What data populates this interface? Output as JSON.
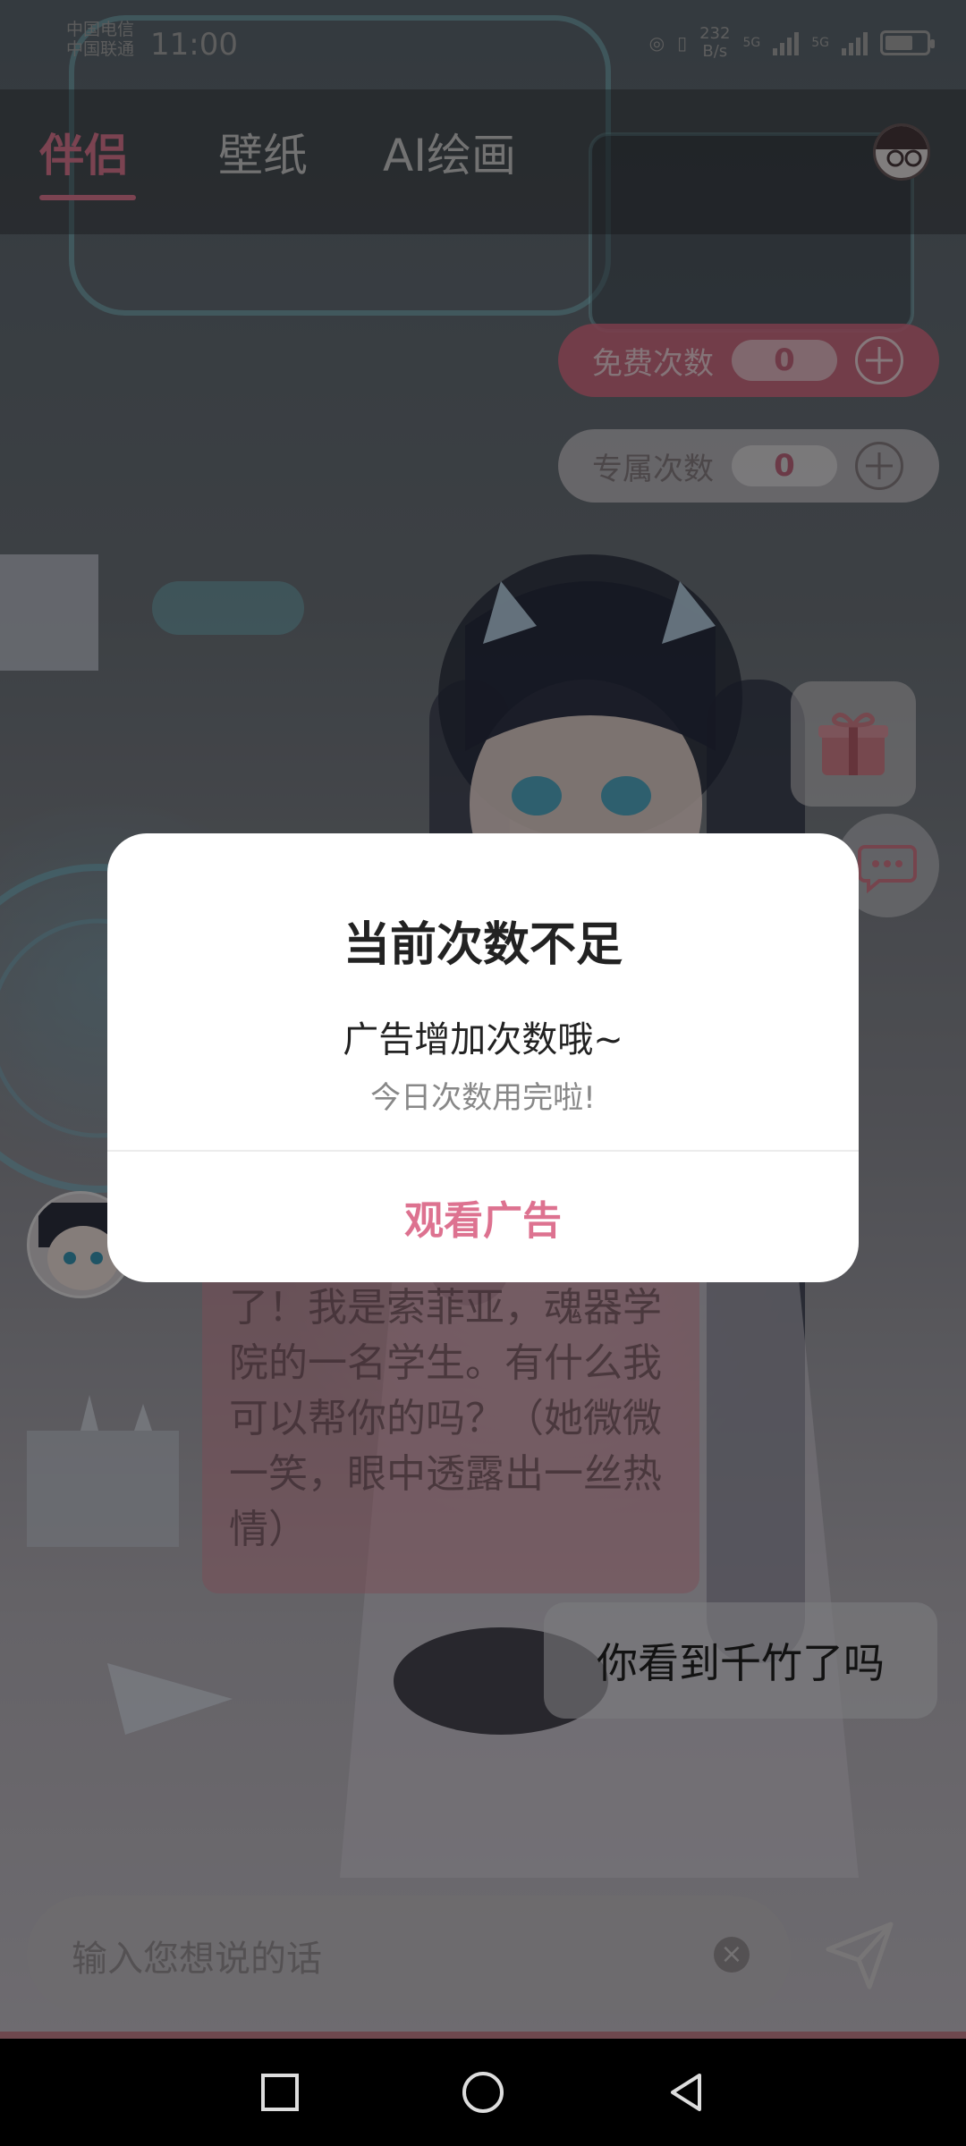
{
  "status_bar": {
    "carrier_1": "中国电信",
    "carrier_2": "中国联通",
    "time": "11:00",
    "speed_value": "232",
    "speed_unit": "B/s",
    "net_1": "5G",
    "net_2": "5G"
  },
  "header": {
    "tabs": [
      {
        "label": "伴侣",
        "active": true
      },
      {
        "label": "壁纸",
        "active": false
      },
      {
        "label": "AI绘画",
        "active": false
      }
    ],
    "accent_color": "#e07a94"
  },
  "counters": {
    "free": {
      "label": "免费次数",
      "value": "0"
    },
    "exclusive": {
      "label": "专属次数",
      "value": "0"
    }
  },
  "chat": {
    "bot_message": "了！我是索菲亚，魂器学院的一名学生。有什么我可以帮你的吗？（她微微一笑，眼中透露出一丝热情）",
    "user_message": "你看到千竹了吗"
  },
  "input": {
    "placeholder": "输入您想说的话"
  },
  "dialog": {
    "title": "当前次数不足",
    "message": "广告增加次数哦~",
    "sub_message": "今日次数用完啦!",
    "action_label": "观看广告"
  },
  "icons": [
    "gift-icon",
    "chat-icon",
    "send-icon",
    "clear-icon",
    "recent-apps-icon",
    "home-icon",
    "back-icon"
  ]
}
